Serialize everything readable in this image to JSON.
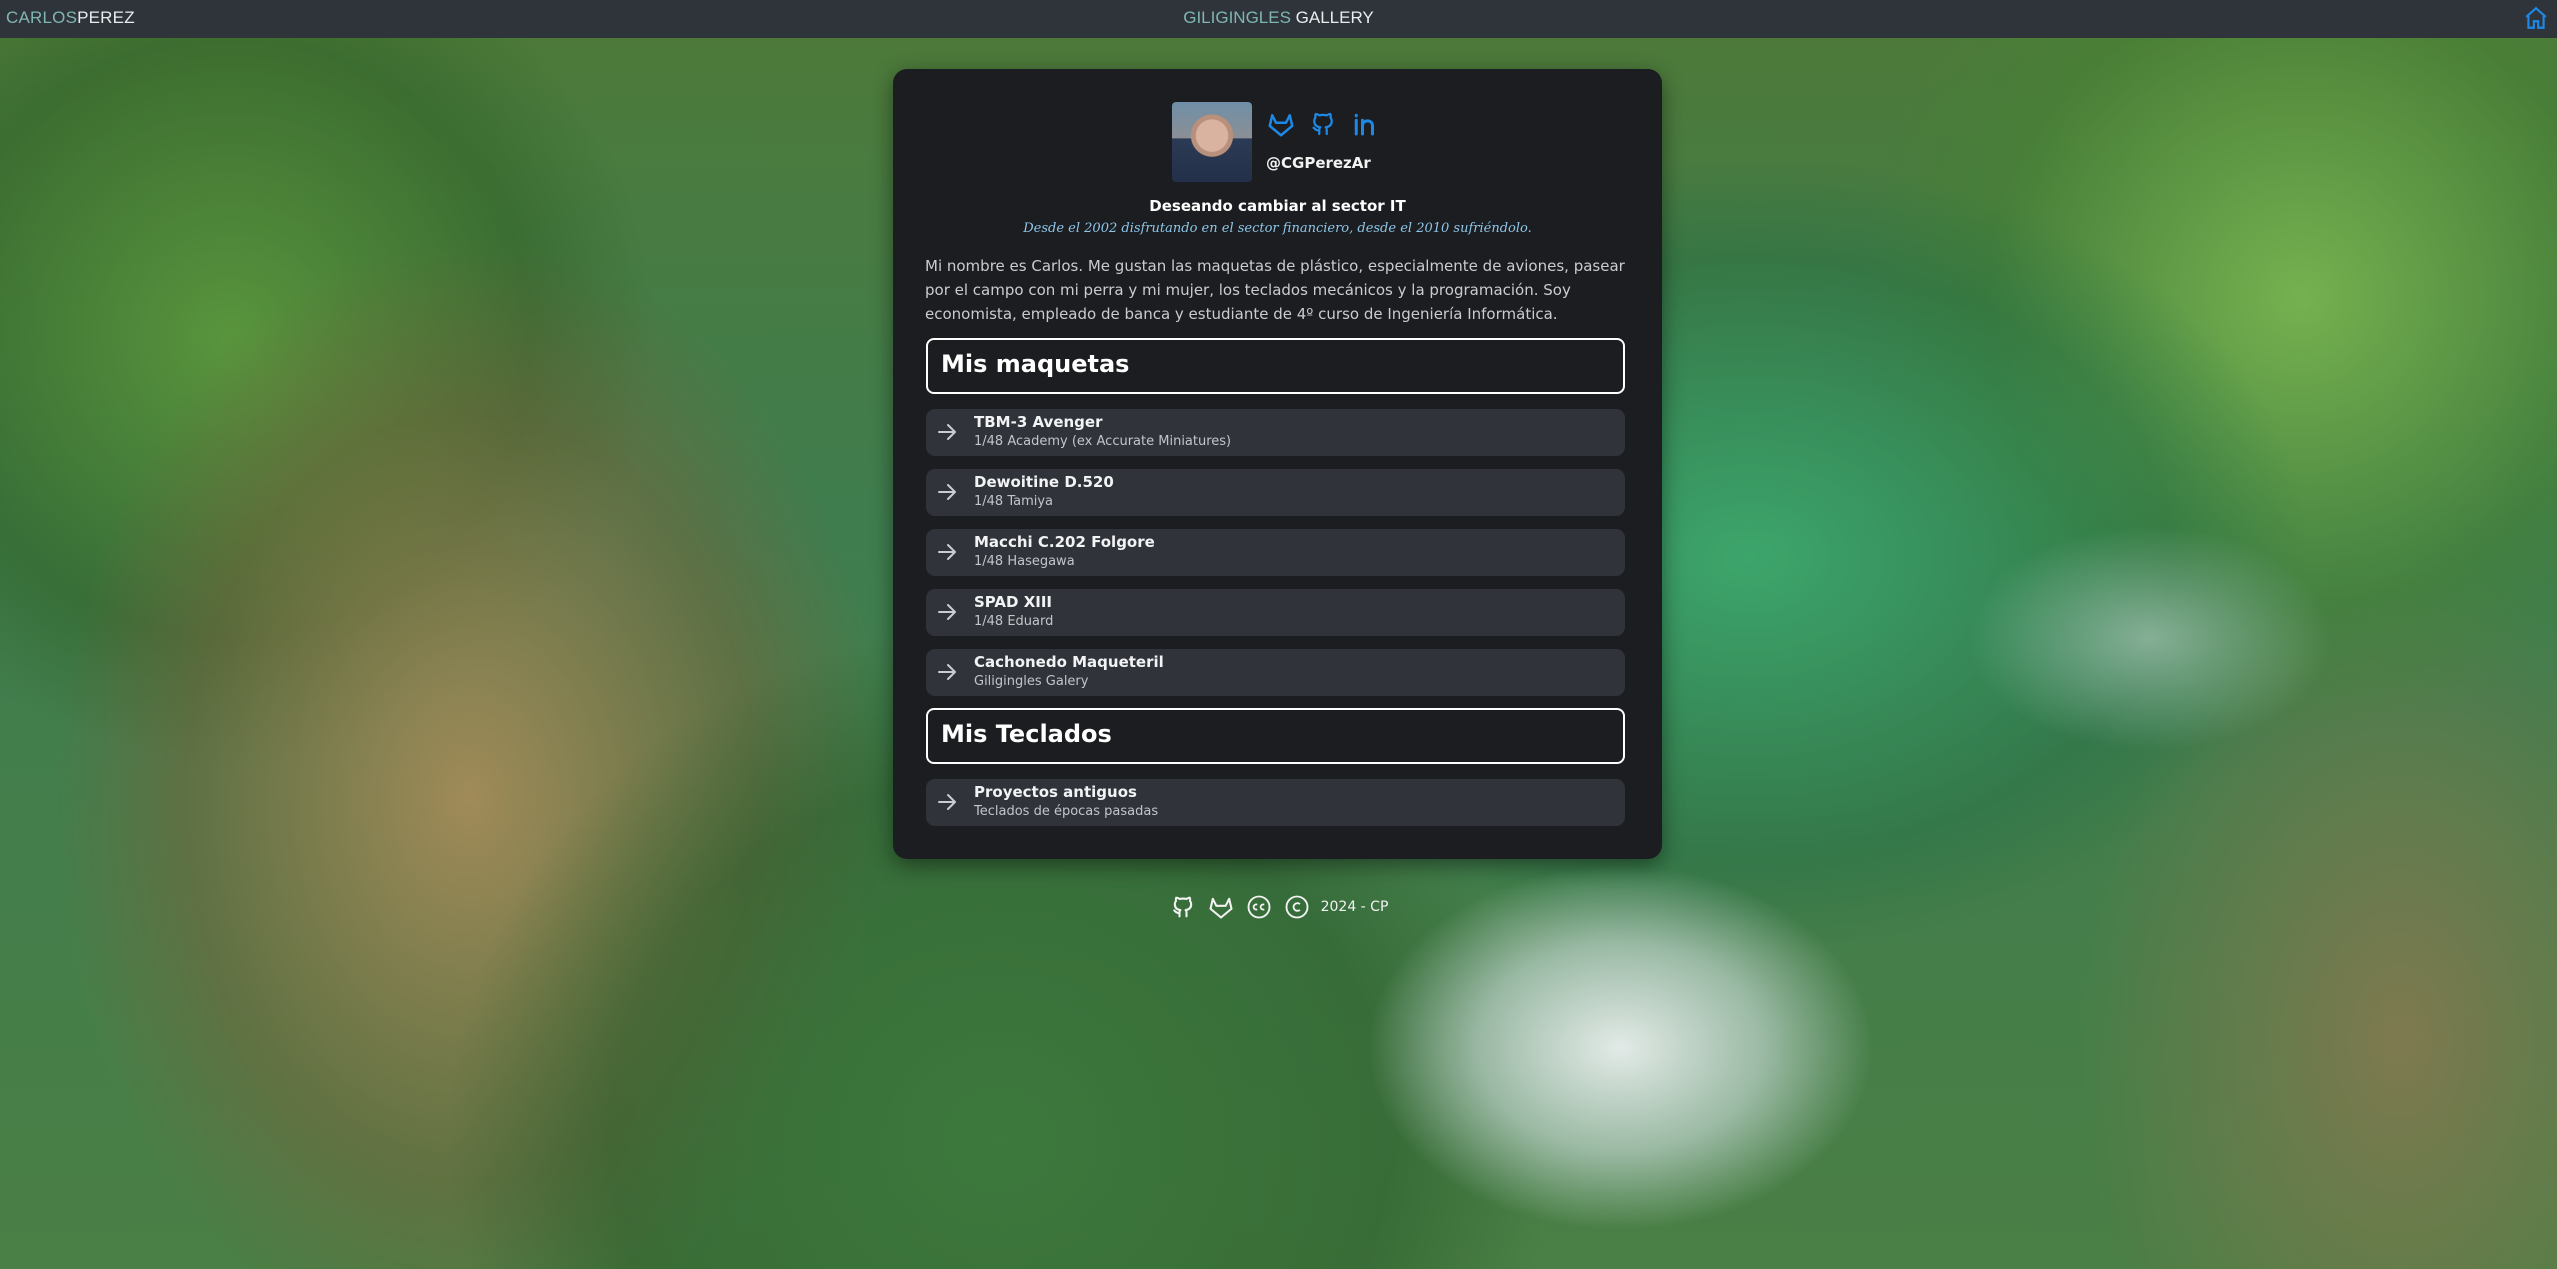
{
  "topbar": {
    "brand_first": "CARLOS",
    "brand_second": "PEREZ",
    "gallery_first": "GILIGINGLES",
    "gallery_second": "GALLERY",
    "home_icon": "home-icon"
  },
  "profile": {
    "handle": "@CGPerezAr",
    "tagline": "Deseando cambiar al sector IT",
    "subtitle": "Desde el 2002 disfrutando en el sector financiero, desde el 2010 sufriéndolo.",
    "bio": "Mi nombre es Carlos. Me gustan las maquetas de plástico, especialmente de aviones, pasear por el campo con mi perra y mi mujer, los teclados mecánicos y la programación. Soy economista, empleado de banca y estudiante de 4º curso de Ingeniería Informática.",
    "social_icons": [
      "gitlab-icon",
      "github-icon",
      "linkedin-icon"
    ]
  },
  "maquetas": {
    "heading": "Mis maquetas",
    "items": [
      {
        "title": "TBM-3 Avenger",
        "sub": "1/48 Academy (ex Accurate Miniatures)"
      },
      {
        "title": "Dewoitine D.520",
        "sub": "1/48 Tamiya"
      },
      {
        "title": "Macchi C.202 Folgore",
        "sub": "1/48 Hasegawa"
      },
      {
        "title": "SPAD XIII",
        "sub": "1/48 Eduard"
      },
      {
        "title": "Cachonedo Maqueteril",
        "sub": "Giligingles Galery"
      }
    ]
  },
  "teclados": {
    "heading": "Mis Teclados",
    "items": [
      {
        "title": "Proyectos antiguos",
        "sub": "Teclados de épocas pasadas"
      }
    ]
  },
  "footer": {
    "text": "2024 - CP",
    "icons": [
      "github-icon",
      "gitlab-icon",
      "creative-commons-icon",
      "copyright-icon"
    ]
  },
  "colors": {
    "topbar_bg": "#2f343b",
    "accent_teal": "#7fb6b3",
    "icon_blue": "#1e88e5",
    "card_bg": "#1b1d20",
    "item_bg": "#30343a",
    "subtitle_blue": "#8ec6ea"
  }
}
